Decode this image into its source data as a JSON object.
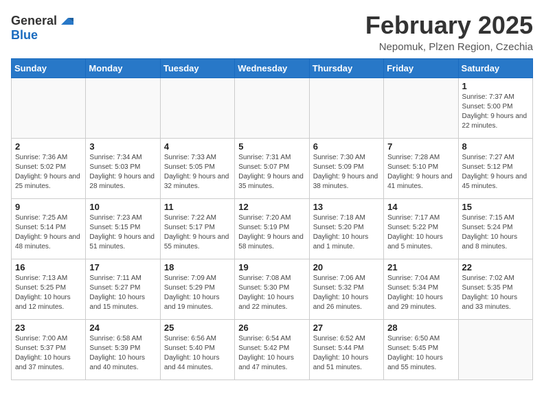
{
  "header": {
    "logo_general": "General",
    "logo_blue": "Blue",
    "month": "February 2025",
    "location": "Nepomuk, Plzen Region, Czechia"
  },
  "weekdays": [
    "Sunday",
    "Monday",
    "Tuesday",
    "Wednesday",
    "Thursday",
    "Friday",
    "Saturday"
  ],
  "weeks": [
    [
      {
        "day": "",
        "info": ""
      },
      {
        "day": "",
        "info": ""
      },
      {
        "day": "",
        "info": ""
      },
      {
        "day": "",
        "info": ""
      },
      {
        "day": "",
        "info": ""
      },
      {
        "day": "",
        "info": ""
      },
      {
        "day": "1",
        "info": "Sunrise: 7:37 AM\nSunset: 5:00 PM\nDaylight: 9 hours and 22 minutes."
      }
    ],
    [
      {
        "day": "2",
        "info": "Sunrise: 7:36 AM\nSunset: 5:02 PM\nDaylight: 9 hours and 25 minutes."
      },
      {
        "day": "3",
        "info": "Sunrise: 7:34 AM\nSunset: 5:03 PM\nDaylight: 9 hours and 28 minutes."
      },
      {
        "day": "4",
        "info": "Sunrise: 7:33 AM\nSunset: 5:05 PM\nDaylight: 9 hours and 32 minutes."
      },
      {
        "day": "5",
        "info": "Sunrise: 7:31 AM\nSunset: 5:07 PM\nDaylight: 9 hours and 35 minutes."
      },
      {
        "day": "6",
        "info": "Sunrise: 7:30 AM\nSunset: 5:09 PM\nDaylight: 9 hours and 38 minutes."
      },
      {
        "day": "7",
        "info": "Sunrise: 7:28 AM\nSunset: 5:10 PM\nDaylight: 9 hours and 41 minutes."
      },
      {
        "day": "8",
        "info": "Sunrise: 7:27 AM\nSunset: 5:12 PM\nDaylight: 9 hours and 45 minutes."
      }
    ],
    [
      {
        "day": "9",
        "info": "Sunrise: 7:25 AM\nSunset: 5:14 PM\nDaylight: 9 hours and 48 minutes."
      },
      {
        "day": "10",
        "info": "Sunrise: 7:23 AM\nSunset: 5:15 PM\nDaylight: 9 hours and 51 minutes."
      },
      {
        "day": "11",
        "info": "Sunrise: 7:22 AM\nSunset: 5:17 PM\nDaylight: 9 hours and 55 minutes."
      },
      {
        "day": "12",
        "info": "Sunrise: 7:20 AM\nSunset: 5:19 PM\nDaylight: 9 hours and 58 minutes."
      },
      {
        "day": "13",
        "info": "Sunrise: 7:18 AM\nSunset: 5:20 PM\nDaylight: 10 hours and 1 minute."
      },
      {
        "day": "14",
        "info": "Sunrise: 7:17 AM\nSunset: 5:22 PM\nDaylight: 10 hours and 5 minutes."
      },
      {
        "day": "15",
        "info": "Sunrise: 7:15 AM\nSunset: 5:24 PM\nDaylight: 10 hours and 8 minutes."
      }
    ],
    [
      {
        "day": "16",
        "info": "Sunrise: 7:13 AM\nSunset: 5:25 PM\nDaylight: 10 hours and 12 minutes."
      },
      {
        "day": "17",
        "info": "Sunrise: 7:11 AM\nSunset: 5:27 PM\nDaylight: 10 hours and 15 minutes."
      },
      {
        "day": "18",
        "info": "Sunrise: 7:09 AM\nSunset: 5:29 PM\nDaylight: 10 hours and 19 minutes."
      },
      {
        "day": "19",
        "info": "Sunrise: 7:08 AM\nSunset: 5:30 PM\nDaylight: 10 hours and 22 minutes."
      },
      {
        "day": "20",
        "info": "Sunrise: 7:06 AM\nSunset: 5:32 PM\nDaylight: 10 hours and 26 minutes."
      },
      {
        "day": "21",
        "info": "Sunrise: 7:04 AM\nSunset: 5:34 PM\nDaylight: 10 hours and 29 minutes."
      },
      {
        "day": "22",
        "info": "Sunrise: 7:02 AM\nSunset: 5:35 PM\nDaylight: 10 hours and 33 minutes."
      }
    ],
    [
      {
        "day": "23",
        "info": "Sunrise: 7:00 AM\nSunset: 5:37 PM\nDaylight: 10 hours and 37 minutes."
      },
      {
        "day": "24",
        "info": "Sunrise: 6:58 AM\nSunset: 5:39 PM\nDaylight: 10 hours and 40 minutes."
      },
      {
        "day": "25",
        "info": "Sunrise: 6:56 AM\nSunset: 5:40 PM\nDaylight: 10 hours and 44 minutes."
      },
      {
        "day": "26",
        "info": "Sunrise: 6:54 AM\nSunset: 5:42 PM\nDaylight: 10 hours and 47 minutes."
      },
      {
        "day": "27",
        "info": "Sunrise: 6:52 AM\nSunset: 5:44 PM\nDaylight: 10 hours and 51 minutes."
      },
      {
        "day": "28",
        "info": "Sunrise: 6:50 AM\nSunset: 5:45 PM\nDaylight: 10 hours and 55 minutes."
      },
      {
        "day": "",
        "info": ""
      }
    ]
  ]
}
